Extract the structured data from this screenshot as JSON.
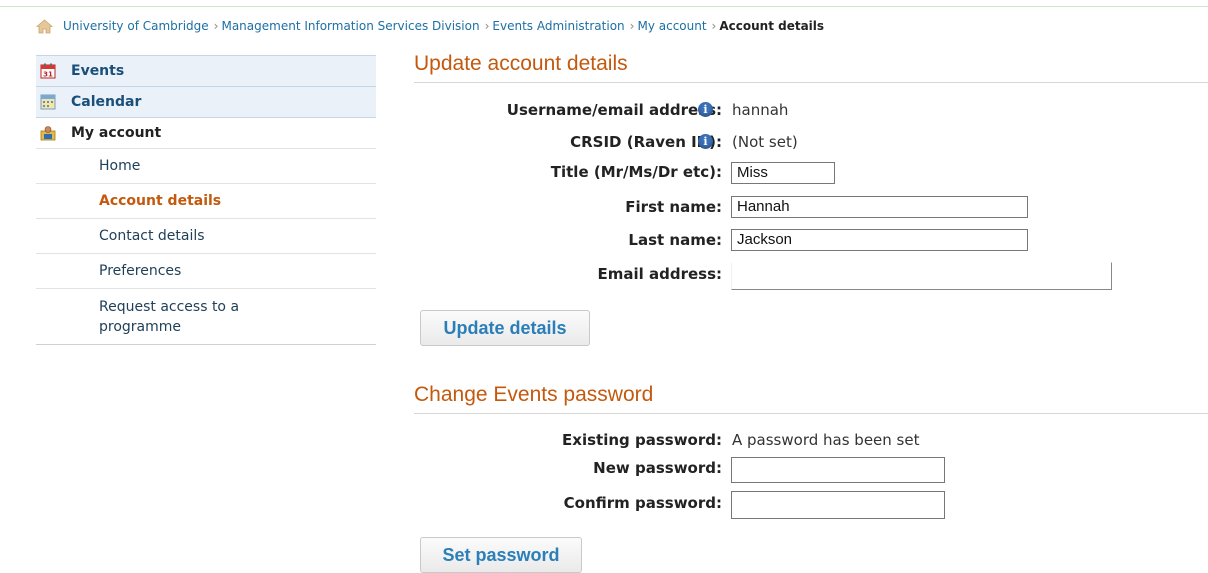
{
  "breadcrumb": {
    "items": [
      "University of Cambridge",
      "Management Information Services Division",
      "Events Administration",
      "My account"
    ],
    "current": "Account details"
  },
  "sidebar": {
    "main": [
      {
        "label": "Events",
        "icon": "calendar-date-icon"
      },
      {
        "label": "Calendar",
        "icon": "calendar-icon"
      },
      {
        "label": "My account",
        "icon": "user-account-icon"
      }
    ],
    "sub": [
      {
        "label": "Home"
      },
      {
        "label": "Account details",
        "active": true
      },
      {
        "label": "Contact details"
      },
      {
        "label": "Preferences"
      },
      {
        "label": "Request access to a programme"
      }
    ]
  },
  "update_section": {
    "title": "Update account details",
    "username_label": "Username/email address:",
    "username_value": "hannah",
    "crsid_label": "CRSID (Raven ID):",
    "crsid_value": "(Not set)",
    "title_label": "Title (Mr/Ms/Dr etc):",
    "title_value": "Miss",
    "first_name_label": "First name:",
    "first_name_value": "Hannah",
    "last_name_label": "Last name:",
    "last_name_value": "Jackson",
    "email_label": "Email address:",
    "email_value": "",
    "button_label": "Update details"
  },
  "password_section": {
    "title": "Change Events password",
    "existing_label": "Existing password:",
    "existing_value": "A password has been set",
    "new_label": "New password:",
    "new_value": "",
    "confirm_label": "Confirm password:",
    "confirm_value": "",
    "button_label": "Set password"
  },
  "colors": {
    "accent": "#c4590e",
    "link": "#1d6fa5",
    "button_text": "#2a7fb8"
  }
}
